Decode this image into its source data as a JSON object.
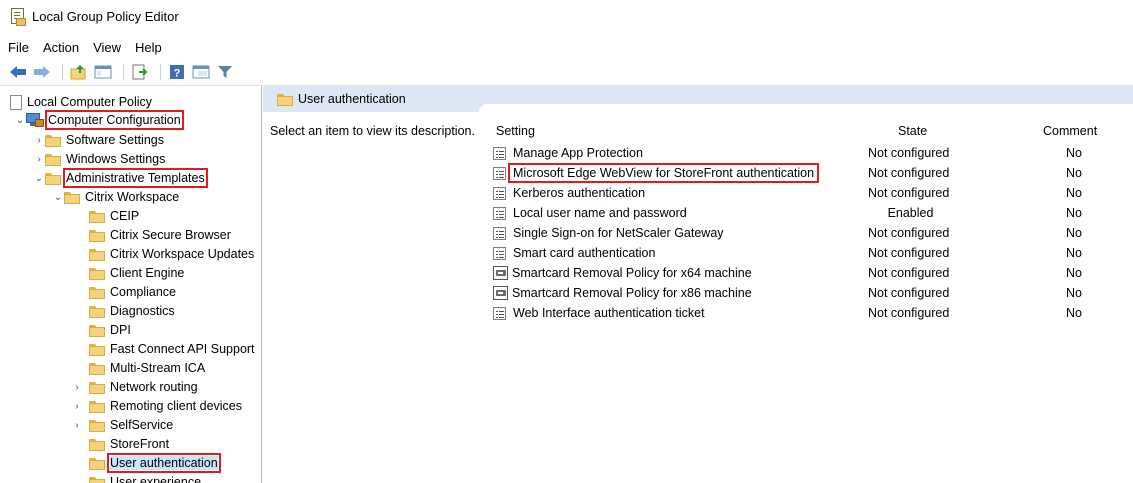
{
  "window": {
    "title": "Local Group Policy Editor"
  },
  "menu": [
    "File",
    "Action",
    "View",
    "Help"
  ],
  "toolbar": {
    "buttons": [
      "back-arrow-icon",
      "forward-arrow-icon",
      "up-folder-icon",
      "show-hide-tree-icon",
      "export-list-icon",
      "help-icon",
      "properties-icon",
      "filter-icon"
    ]
  },
  "tree": {
    "root": "Local Computer Policy",
    "computer_configuration": "Computer Configuration",
    "software_settings": "Software Settings",
    "windows_settings": "Windows Settings",
    "administrative_templates": "Administrative Templates",
    "citrix_workspace": "Citrix Workspace",
    "children": [
      {
        "label": "CEIP",
        "expandable": false
      },
      {
        "label": "Citrix Secure Browser",
        "expandable": false
      },
      {
        "label": "Citrix Workspace Updates",
        "expandable": false
      },
      {
        "label": "Client Engine",
        "expandable": false
      },
      {
        "label": "Compliance",
        "expandable": false
      },
      {
        "label": "Diagnostics",
        "expandable": false
      },
      {
        "label": "DPI",
        "expandable": false
      },
      {
        "label": "Fast Connect API Support",
        "expandable": false
      },
      {
        "label": "Multi-Stream ICA",
        "expandable": false
      },
      {
        "label": "Network routing",
        "expandable": true
      },
      {
        "label": "Remoting client devices",
        "expandable": true
      },
      {
        "label": "SelfService",
        "expandable": true
      },
      {
        "label": "StoreFront",
        "expandable": false
      },
      {
        "label": "User authentication",
        "expandable": false,
        "selected": true
      },
      {
        "label": "User experience",
        "expandable": false
      }
    ]
  },
  "detail": {
    "header_title": "User authentication",
    "description_hint": "Select an item to view its description.",
    "columns": {
      "setting": "Setting",
      "state": "State",
      "comment": "Comment"
    },
    "rows": [
      {
        "setting": "Manage App Protection",
        "state": "Not configured",
        "comment": "No"
      },
      {
        "setting": "Microsoft Edge WebView for StoreFront authentication",
        "state": "Not configured",
        "comment": "No"
      },
      {
        "setting": "Kerberos authentication",
        "state": "Not configured",
        "comment": "No"
      },
      {
        "setting": "Local user name and password",
        "state": "Enabled",
        "comment": "No"
      },
      {
        "setting": "Single Sign-on for NetScaler Gateway",
        "state": "Not configured",
        "comment": "No"
      },
      {
        "setting": "Smart card authentication",
        "state": "Not configured",
        "comment": "No"
      },
      {
        "setting": "Smartcard Removal Policy for x64 machine",
        "state": "Not configured",
        "comment": "No"
      },
      {
        "setting": "Smartcard Removal Policy for x86 machine",
        "state": "Not configured",
        "comment": "No"
      },
      {
        "setting": "Web Interface authentication ticket",
        "state": "Not configured",
        "comment": "No"
      }
    ]
  },
  "colors": {
    "highlight": "#e01b24",
    "header_bg": "#dce6f4",
    "selection": "#cce4f7"
  }
}
